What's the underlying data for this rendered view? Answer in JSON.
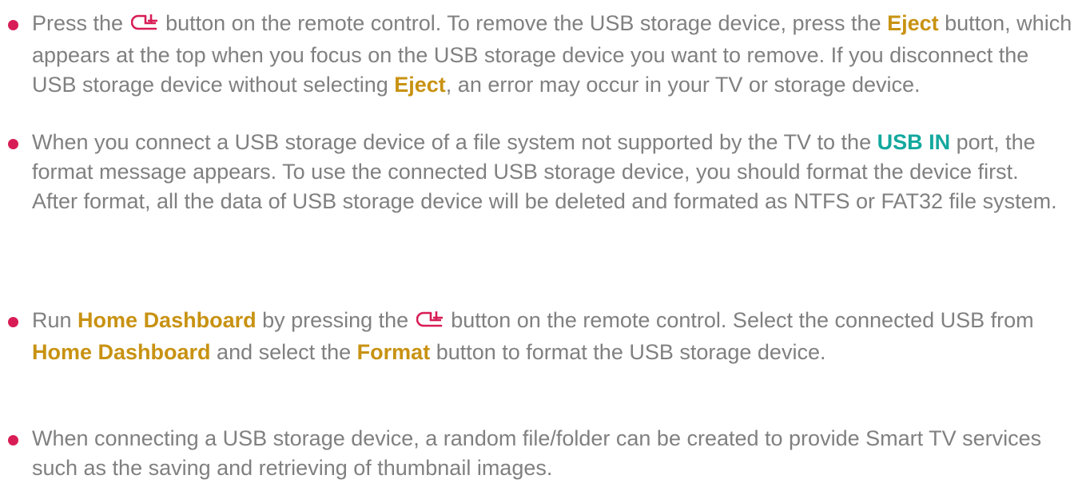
{
  "colors": {
    "bullet": "#d81d56",
    "text": "#808080",
    "highlight_gold": "#c89212",
    "highlight_teal": "#13a89e",
    "icon": "#d81d56"
  },
  "items": [
    {
      "t1": "Press the ",
      "icon": "home-icon",
      "t2": " button on the remote control. To remove the USB storage device, press the ",
      "kw1": "Eject",
      "t3": " button, which appears at the top when you focus on the USB storage device you want to remove. If you disconnect the USB storage device without selecting ",
      "kw2": "Eject",
      "t4": ", an error may occur in your TV or storage device."
    },
    {
      "t1": "When you connect a USB storage device of a file system not supported by the TV to the ",
      "kw1": "USB IN",
      "t2": " port, the format message appears. To use the connected USB storage device, you should format the device first.",
      "t3": "After format, all the data of USB storage device will be deleted and formated as NTFS or FAT32 file system."
    },
    {
      "t1": "Run ",
      "kw1": "Home Dashboard",
      "t2": " by pressing the ",
      "icon": "home-icon",
      "t3": " button on the remote control. Select the connected USB from ",
      "kw2": "Home Dashboard",
      "t4": " and select the ",
      "kw3": "Format",
      "t5": " button to format the USB storage device."
    },
    {
      "t1": "When connecting a USB storage device, a random file/folder can be created to provide Smart TV services such as the saving and retrieving of thumbnail images."
    }
  ]
}
